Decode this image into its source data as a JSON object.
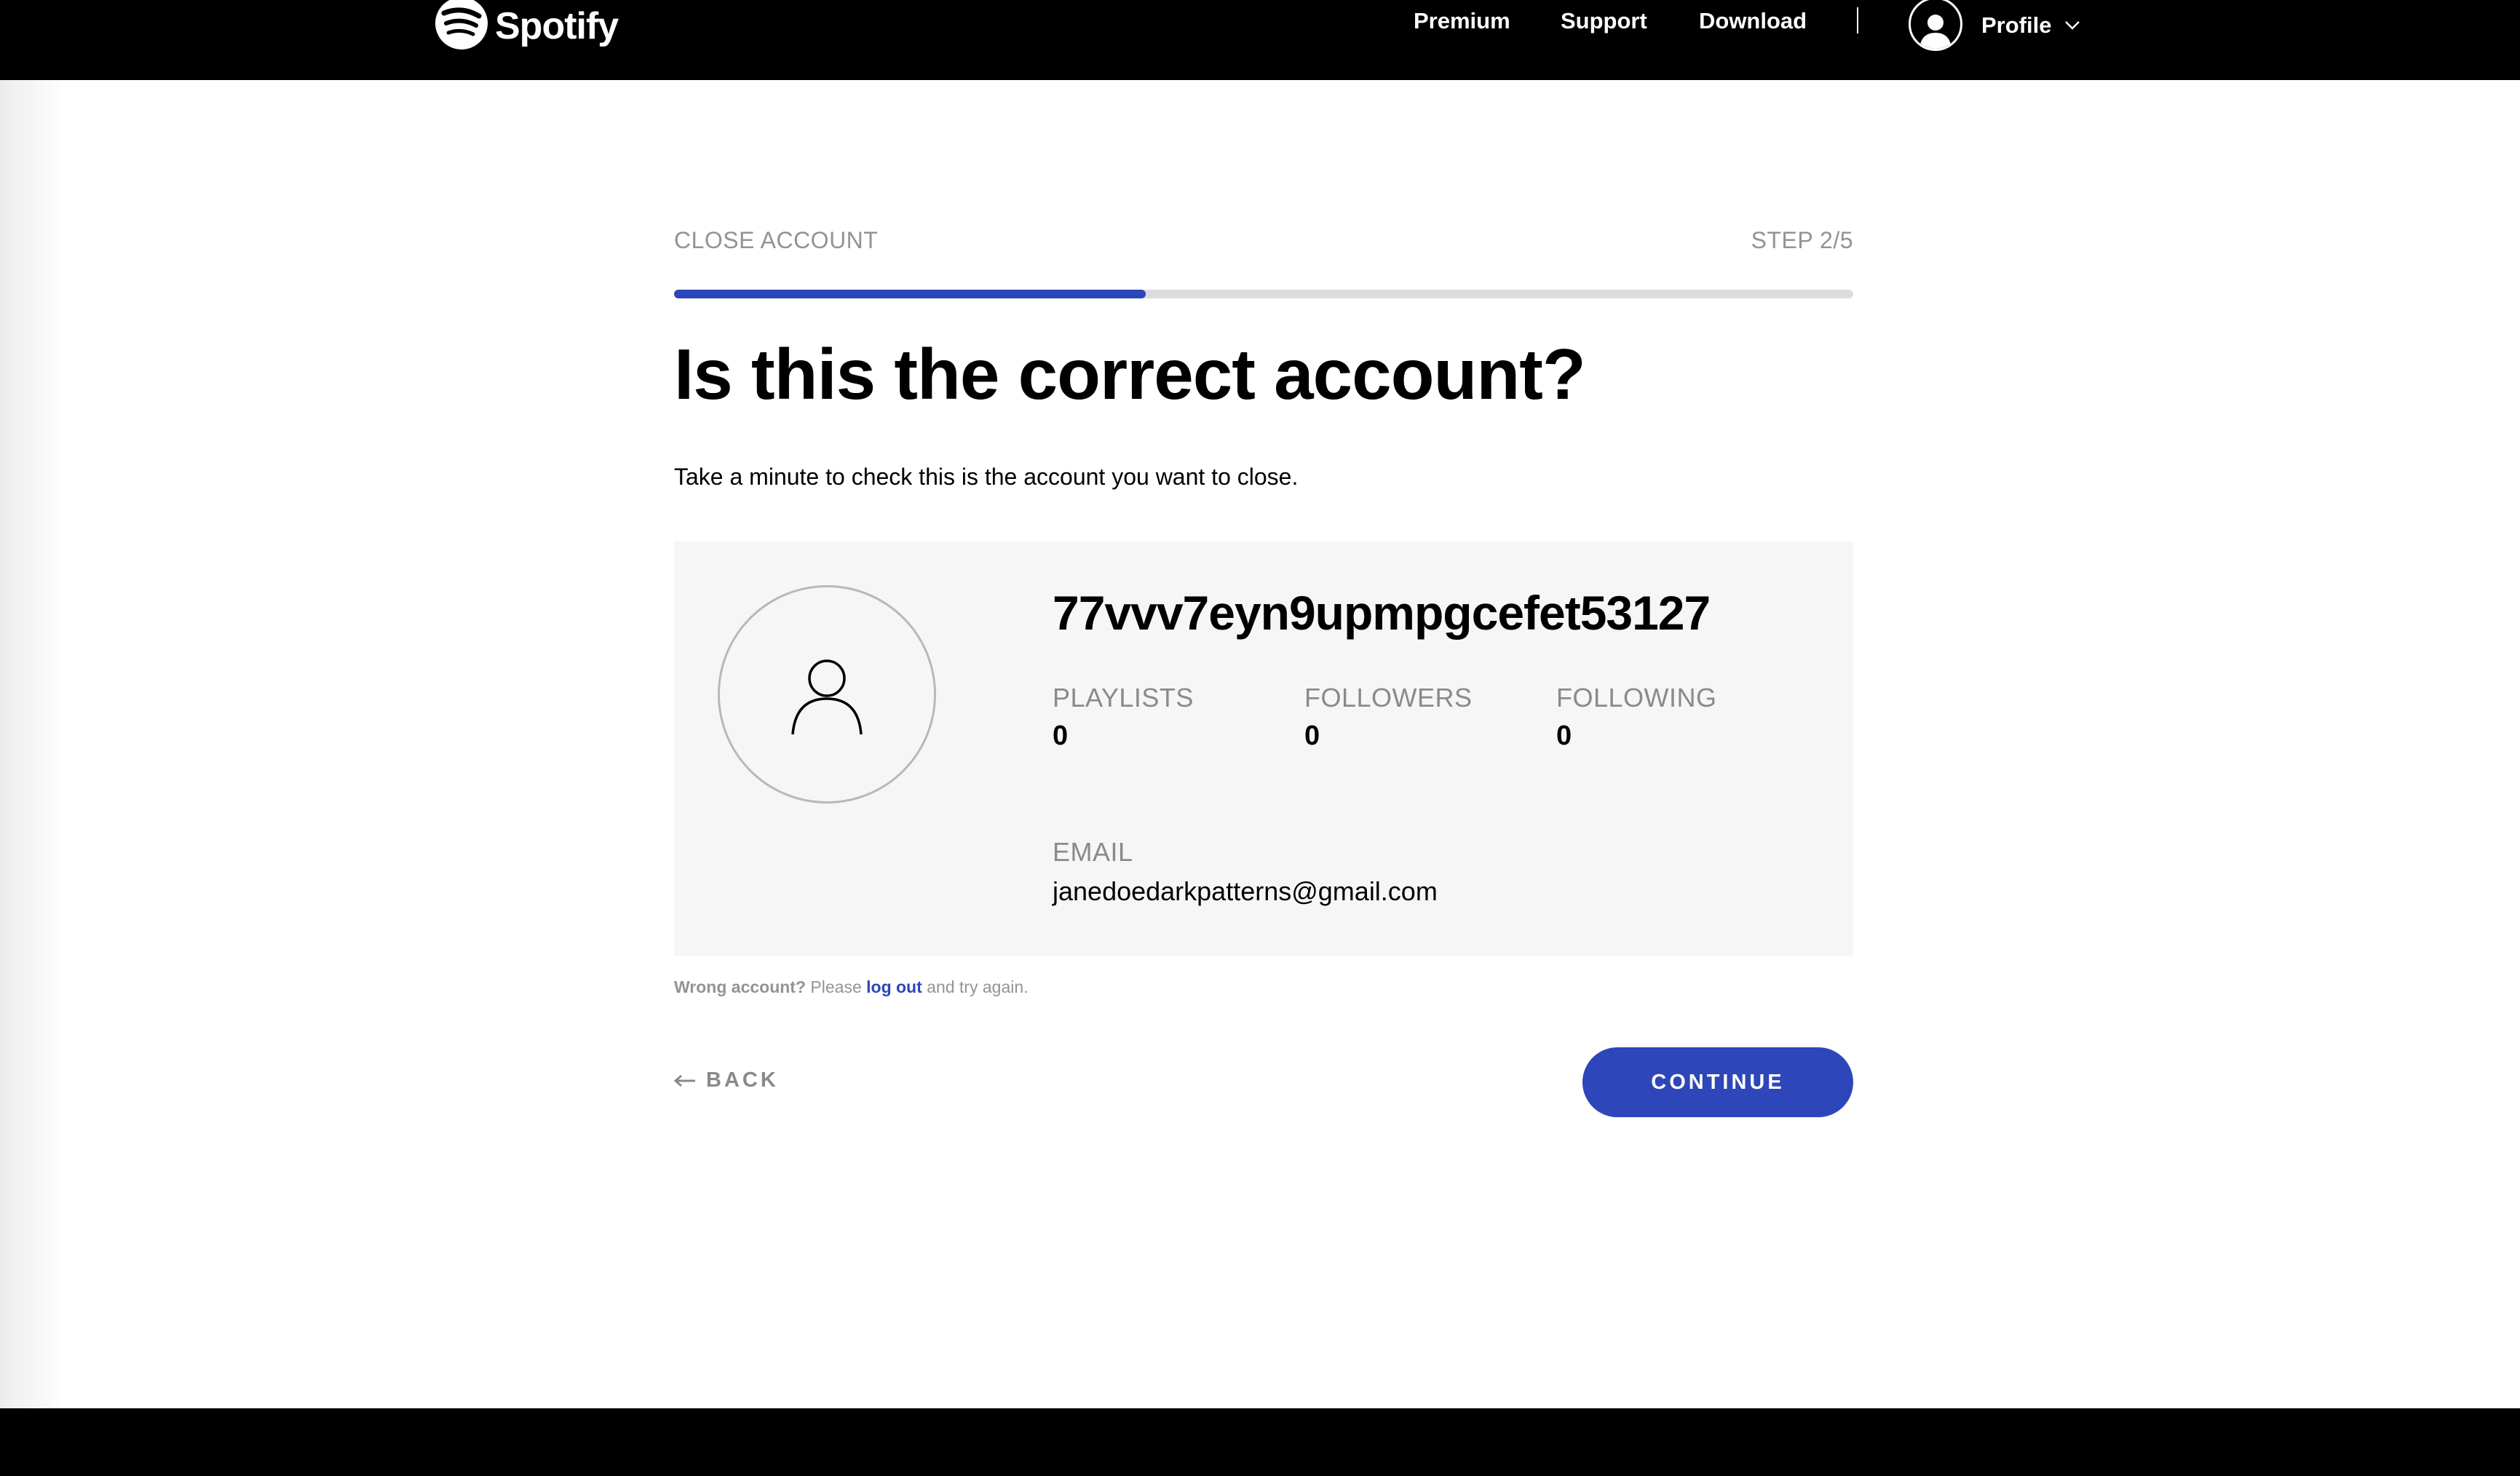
{
  "header": {
    "brand": "Spotify",
    "nav": {
      "premium": "Premium",
      "support": "Support",
      "download": "Download",
      "separator": "|"
    },
    "profile_label": "Profile",
    "icons": [
      "spotify-logo-icon",
      "user-icon",
      "chevron-down-icon"
    ]
  },
  "flow": {
    "title": "CLOSE ACCOUNT",
    "step": "STEP 2/5",
    "progress": 0.4
  },
  "heading": "Is this the correct account?",
  "subtext": "Take a minute to check this is the account you want to close.",
  "account": {
    "username": "77vvv7eyn9upmpgcefet53127",
    "stats": [
      {
        "label": "PLAYLISTS",
        "value": "0"
      },
      {
        "label": "FOLLOWERS",
        "value": "0"
      },
      {
        "label": "FOLLOWING",
        "value": "0"
      }
    ],
    "email_label": "EMAIL",
    "email": "janedoedarkpatterns@gmail.com"
  },
  "wrong_account": {
    "prefix": "Wrong account?",
    "middle": "Please",
    "link": "log out",
    "suffix": "and try again."
  },
  "actions": {
    "back": "BACK",
    "continue": "CONTINUE"
  },
  "colors": {
    "accent": "#2d46b9",
    "header_bg": "#000000",
    "card_bg": "#f6f6f6",
    "muted": "#919496"
  }
}
